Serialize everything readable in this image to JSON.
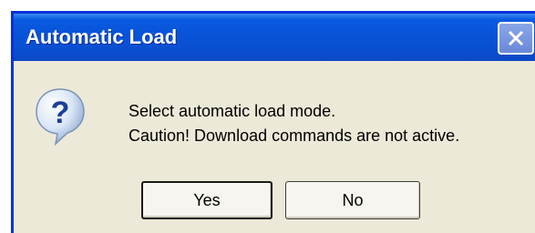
{
  "window": {
    "title": "Automatic Load",
    "close_icon": "close-x-icon"
  },
  "dialog": {
    "icon": "question-icon",
    "icon_glyph": "?",
    "message_line1": "Select automatic load mode.",
    "message_line2": "Caution! Download commands are not active."
  },
  "buttons": {
    "yes_label": "Yes",
    "no_label": "No"
  },
  "colors": {
    "titlebar": "#0a55de",
    "dialog_bg": "#ece9d8",
    "border": "#0831d9"
  }
}
